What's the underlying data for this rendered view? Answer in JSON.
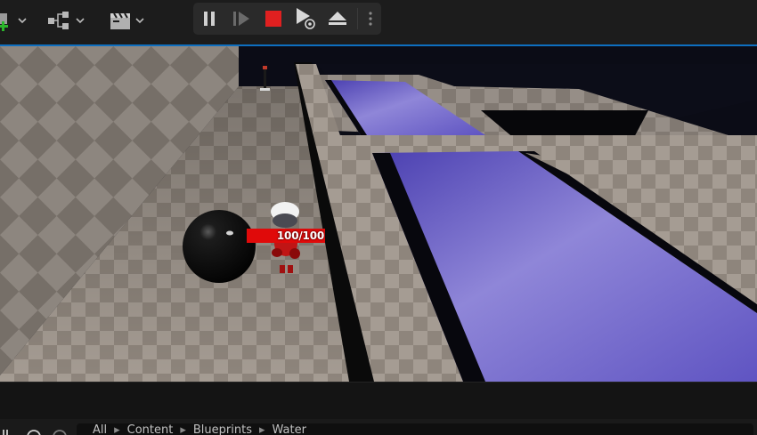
{
  "toolbar": {
    "left_icons": [
      "add-actor-icon",
      "blueprint-graph-icon",
      "cinematics-clapper-icon"
    ],
    "play_controls": [
      "pause-icon",
      "frame-skip-icon",
      "stop-icon",
      "possess-eject-icon",
      "eject-icon",
      "more-options-icon"
    ],
    "accent_color": "#0e6fc0",
    "stop_color": "#e02020"
  },
  "viewport": {
    "health_bar": {
      "text": "100/100",
      "value": 100,
      "max": 100,
      "color": "#e00a0a"
    }
  },
  "content_browser": {
    "breadcrumbs": [
      "All",
      "Content",
      "Blueprints",
      "Water"
    ]
  }
}
